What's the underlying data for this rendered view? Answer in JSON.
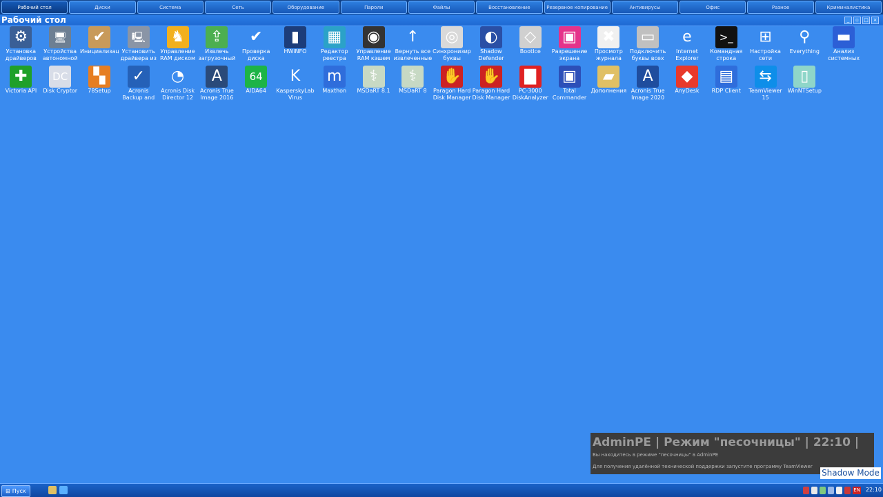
{
  "top_tabs": [
    "Рабочий стол",
    "Диски",
    "Система",
    "Сеть",
    "Оборудование",
    "Пароли",
    "Файлы",
    "Восстановление",
    "Резервное копирование",
    "Антивирусы",
    "Офис",
    "Разное",
    "Криминалистика"
  ],
  "window": {
    "title": "Рабочий стол"
  },
  "desktop_rows": [
    [
      {
        "label": "Установка драйверов",
        "icon": "driver-install-icon",
        "glyph": "⚙",
        "bg": "#3a5f96"
      },
      {
        "label": "Устройства автономной",
        "icon": "offline-devices-icon",
        "glyph": "🖥",
        "bg": "#6d7f93"
      },
      {
        "label": "Инициализация",
        "icon": "init-icon",
        "glyph": "✔",
        "bg": "#c89a5a"
      },
      {
        "label": "Установить драйвера из",
        "icon": "driver-setup-icon",
        "glyph": "🖳",
        "bg": "#8a95a6"
      },
      {
        "label": "Управление RAM диском",
        "icon": "ramdisk-icon",
        "glyph": "♞",
        "bg": "#f2b01e"
      },
      {
        "label": "Извлечь загрузочный",
        "icon": "extract-boot-icon",
        "glyph": "⇪",
        "bg": "#4caf50"
      },
      {
        "label": "Проверка диска",
        "icon": "check-disk-icon",
        "glyph": "✔",
        "bg": "#3a8bef"
      },
      {
        "label": "HWiNFO",
        "icon": "hwinfo-icon",
        "glyph": "▮",
        "bg": "#1c3d7a"
      },
      {
        "label": "Редактор реестра",
        "icon": "regedit-icon",
        "glyph": "▦",
        "bg": "#2ba2c8"
      },
      {
        "label": "Управление RAM кэшем",
        "icon": "ram-cache-icon",
        "glyph": "◉",
        "bg": "#333333"
      },
      {
        "label": "Вернуть все извлеченные",
        "icon": "return-extracted-icon",
        "glyph": "↑",
        "bg": "#3a8bef"
      },
      {
        "label": "Синхронизировать буквы",
        "icon": "sync-letters-icon",
        "glyph": "◎",
        "bg": "#d9d9d9"
      },
      {
        "label": "Shadow Defender",
        "icon": "shadow-defender-icon",
        "glyph": "◐",
        "bg": "#2a4fa5"
      },
      {
        "label": "BootIce",
        "icon": "bootice-icon",
        "glyph": "◇",
        "bg": "#d0d0d0"
      },
      {
        "label": "Разрешение экрана",
        "icon": "screen-resolution-icon",
        "glyph": "▣",
        "bg": "#e5338a"
      },
      {
        "label": "Просмотр журнала",
        "icon": "event-log-icon",
        "glyph": "✖",
        "bg": "#f0f0f0"
      },
      {
        "label": "Подключить буквы всех",
        "icon": "mount-letters-icon",
        "glyph": "▭",
        "bg": "#c0c0c0"
      },
      {
        "label": "Internet Explorer",
        "icon": "internet-explorer-icon",
        "glyph": "e",
        "bg": "#3a8bef"
      },
      {
        "label": "Командная строка",
        "icon": "cmd-icon",
        "glyph": ">_",
        "bg": "#111111"
      },
      {
        "label": "Настройка сети",
        "icon": "network-settings-icon",
        "glyph": "⊞",
        "bg": "#3a8bef"
      },
      {
        "label": "Everything",
        "icon": "everything-search-icon",
        "glyph": "⚲",
        "bg": "#3a8bef"
      },
      {
        "label": "Анализ системных",
        "icon": "system-analysis-icon",
        "glyph": "▬",
        "bg": "#2c5fd6"
      }
    ],
    [
      {
        "label": "Victoria API",
        "icon": "victoria-icon",
        "glyph": "✚",
        "bg": "#1fa02a"
      },
      {
        "label": "Disk Cryptor",
        "icon": "disk-cryptor-icon",
        "glyph": "DC",
        "bg": "#d8dde8"
      },
      {
        "label": "78Setup",
        "icon": "78setup-icon",
        "glyph": "▚",
        "bg": "#e67e22"
      },
      {
        "label": "Acronis Backup and",
        "icon": "acronis-backup-icon",
        "glyph": "✓",
        "bg": "#2561b8"
      },
      {
        "label": "Acronis Disk Director 12",
        "icon": "acronis-disk-director-icon",
        "glyph": "◔",
        "bg": "#3a8bef"
      },
      {
        "label": "Acronis True Image 2016",
        "icon": "acronis-true-image-2016-icon",
        "glyph": "A",
        "bg": "#2a4a7a"
      },
      {
        "label": "AIDA64",
        "icon": "aida64-icon",
        "glyph": "64",
        "bg": "#1db446"
      },
      {
        "label": "KasperskyLab Virus Removal",
        "icon": "kaspersky-icon",
        "glyph": "K",
        "bg": "#3a8bef"
      },
      {
        "label": "Maxthon",
        "icon": "maxthon-icon",
        "glyph": "m",
        "bg": "#2f6ddb"
      },
      {
        "label": "MSDaRT 8.1",
        "icon": "msdart-81-icon",
        "glyph": "⚕",
        "bg": "#c7d9c4"
      },
      {
        "label": "MSDaRT 8",
        "icon": "msdart-8-icon",
        "glyph": "⚕",
        "bg": "#c7d9c4"
      },
      {
        "label": "Paragon Hard Disk Manager",
        "icon": "paragon-hdm-icon",
        "glyph": "✋",
        "bg": "#cc2222"
      },
      {
        "label": "Paragon Hard Disk Manager",
        "icon": "paragon-hdm-2-icon",
        "glyph": "✋",
        "bg": "#cc2222"
      },
      {
        "label": "PC-3000 DiskAnalyzer",
        "icon": "pc3000-icon",
        "glyph": "▇",
        "bg": "#e02222"
      },
      {
        "label": "Total Commander",
        "icon": "total-commander-icon",
        "glyph": "▣",
        "bg": "#2c4fb8"
      },
      {
        "label": "Дополнения",
        "icon": "folder-icon",
        "glyph": "▰",
        "bg": "#e0c064"
      },
      {
        "label": "Acronis True Image 2020",
        "icon": "acronis-true-image-2020-icon",
        "glyph": "A",
        "bg": "#1f4d9e"
      },
      {
        "label": "AnyDesk",
        "icon": "anydesk-icon",
        "glyph": "◆",
        "bg": "#e8392b"
      },
      {
        "label": "RDP Client",
        "icon": "rdp-client-icon",
        "glyph": "▤",
        "bg": "#2f6ddb"
      },
      {
        "label": "TeamViewer 15",
        "icon": "teamviewer-icon",
        "glyph": "⇆",
        "bg": "#0e8ee9"
      },
      {
        "label": "WinNTSetup",
        "icon": "winntsetup-icon",
        "glyph": "▯",
        "bg": "#8fd6c9"
      }
    ]
  ],
  "notification": {
    "heading": "AdminPE | Режим \"песочницы\" | 22:10 |",
    "line1": "Вы находитесь в режиме \"песочницы\" в AdminPE",
    "line2": "Для получения удалённой технической поддержки запустите программу TeamViewer"
  },
  "shadow_mode_label": "Shadow Mode",
  "taskbar": {
    "start_label": "Пуск",
    "clock": "22:10",
    "language": "EN"
  },
  "colors": {
    "desktop": "#3a8bef",
    "taskbar": "#1a63c8",
    "topbar": "#0d3f87"
  }
}
